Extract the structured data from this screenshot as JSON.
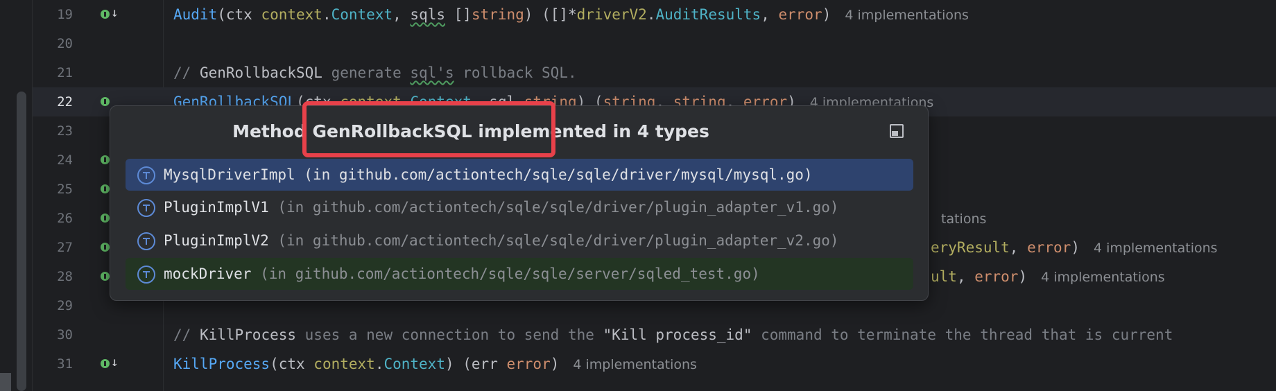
{
  "editor": {
    "lines": [
      {
        "number": "19",
        "tokens": [
          [
            "fn",
            "Audit"
          ],
          [
            "id",
            "(ctx "
          ],
          [
            "pkg",
            "context"
          ],
          [
            "id",
            "."
          ],
          [
            "typ",
            "Context"
          ],
          [
            "id",
            ", "
          ],
          [
            "squig",
            "sqls"
          ],
          [
            "id",
            " []"
          ],
          [
            "kw",
            "string"
          ],
          [
            "id",
            ") ([]*"
          ],
          [
            "pkg",
            "driverV2"
          ],
          [
            "id",
            "."
          ],
          [
            "typ",
            "AuditResults"
          ],
          [
            "id",
            ", "
          ],
          [
            "kw",
            "error"
          ],
          [
            "id",
            ")"
          ]
        ],
        "hint": "4 implementations"
      },
      {
        "number": "20",
        "tokens": [],
        "hint": ""
      },
      {
        "number": "21",
        "tokens": [
          [
            "cmt",
            "// "
          ],
          [
            "cmt-strong",
            "GenRollbackSQL"
          ],
          [
            "cmt",
            " generate "
          ],
          [
            "cmt squig",
            "sql's"
          ],
          [
            "cmt",
            " rollback SQL."
          ]
        ],
        "hint": ""
      },
      {
        "number": "22",
        "tokens": [
          [
            "fn",
            "GenRollbackSQL"
          ],
          [
            "id",
            "(ctx "
          ],
          [
            "pkg",
            "context"
          ],
          [
            "id",
            "."
          ],
          [
            "typ",
            "Context"
          ],
          [
            "id",
            ", sql "
          ],
          [
            "kw",
            "string"
          ],
          [
            "id",
            ") ("
          ],
          [
            "kw",
            "string"
          ],
          [
            "id",
            ", "
          ],
          [
            "kw",
            "string"
          ],
          [
            "id",
            ", "
          ],
          [
            "kw",
            "error"
          ],
          [
            "id",
            ")"
          ]
        ],
        "hint": "4 implementations"
      },
      {
        "number": "23",
        "tokens": [],
        "hint": ""
      },
      {
        "number": "24",
        "tokens": [],
        "hint": ""
      },
      {
        "number": "25",
        "tokens": [],
        "hint": ""
      },
      {
        "number": "26",
        "tokens": [],
        "hint": "tations"
      },
      {
        "number": "27",
        "tokens": [],
        "hint": ""
      },
      {
        "number": "28",
        "tokens": [],
        "hint": ""
      },
      {
        "number": "29",
        "tokens": [],
        "hint": ""
      },
      {
        "number": "30",
        "tokens": [
          [
            "cmt",
            "// "
          ],
          [
            "cmt-strong",
            "KillProcess"
          ],
          [
            "cmt",
            " uses a new connection to send the "
          ],
          [
            "cmt-strong",
            "\"Kill process_id\""
          ],
          [
            "cmt",
            " command to terminate the thread that is current"
          ]
        ],
        "hint": ""
      },
      {
        "number": "31",
        "tokens": [
          [
            "fn",
            "KillProcess"
          ],
          [
            "id",
            "(ctx "
          ],
          [
            "pkg",
            "context"
          ],
          [
            "id",
            "."
          ],
          [
            "typ",
            "Context"
          ],
          [
            "id",
            ") (err "
          ],
          [
            "kw",
            "error"
          ],
          [
            "id",
            ")"
          ]
        ],
        "hint": "4 implementations"
      }
    ],
    "overflow_right": {
      "line27": [
        [
          "pkg",
          "eryResult"
        ],
        [
          "id",
          ", "
        ],
        [
          "kw",
          "error"
        ],
        [
          "id",
          ")"
        ]
      ],
      "line27_hint": "4 implementations",
      "line28": [
        [
          "pkg",
          "ult"
        ],
        [
          "id",
          ", "
        ],
        [
          "kw",
          "error"
        ],
        [
          "id",
          ")"
        ]
      ],
      "line28_hint": "4 implementations"
    }
  },
  "popup": {
    "title": "Method GenRollbackSQL implemented in 4 types",
    "items": [
      {
        "name": "MysqlDriverImpl",
        "location": " (in github.com/actiontech/sqle/sqle/driver/mysql/mysql.go)",
        "icon": "type-icon"
      },
      {
        "name": "PluginImplV1",
        "location": " (in github.com/actiontech/sqle/sqle/driver/plugin_adapter_v1.go)",
        "icon": "type-icon"
      },
      {
        "name": "PluginImplV2",
        "location": " (in github.com/actiontech/sqle/sqle/driver/plugin_adapter_v2.go)",
        "icon": "type-icon"
      },
      {
        "name": "mockDriver",
        "location": " (in github.com/actiontech/sqle/sqle/server/sqled_test.go)",
        "icon": "type-icon"
      }
    ]
  },
  "colors": {
    "background": "#1e1f22",
    "function": "#56a8f5",
    "keyword": "#cf8e6d",
    "type": "#4fb3c7",
    "package": "#b3ae60",
    "selection": "#2e436e",
    "annotation_box": "#e8414a"
  }
}
